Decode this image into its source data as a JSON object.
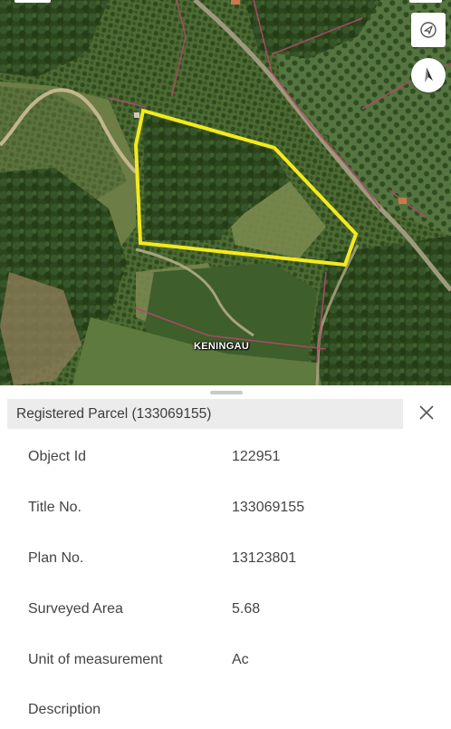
{
  "map": {
    "place_label": "KENINGAU",
    "icons": {
      "location": "navigation-arrow-icon",
      "compass": "compass-north-icon"
    },
    "colors": {
      "parcel_outline": "#f4ea1c",
      "boundary_lines": "#b04a6a",
      "vegetation_dark": "#2d4a1f",
      "vegetation_light": "#6b8a44"
    }
  },
  "panel": {
    "title": "Registered Parcel (133069155)",
    "close_icon": "close-icon",
    "attributes": [
      {
        "label": "Object Id",
        "value": "122951"
      },
      {
        "label": "Title No.",
        "value": "133069155"
      },
      {
        "label": "Plan No.",
        "value": "13123801"
      },
      {
        "label": "Surveyed Area",
        "value": "5.68"
      },
      {
        "label": "Unit of measurement",
        "value": "Ac"
      },
      {
        "label": "Description",
        "value": ""
      }
    ]
  }
}
